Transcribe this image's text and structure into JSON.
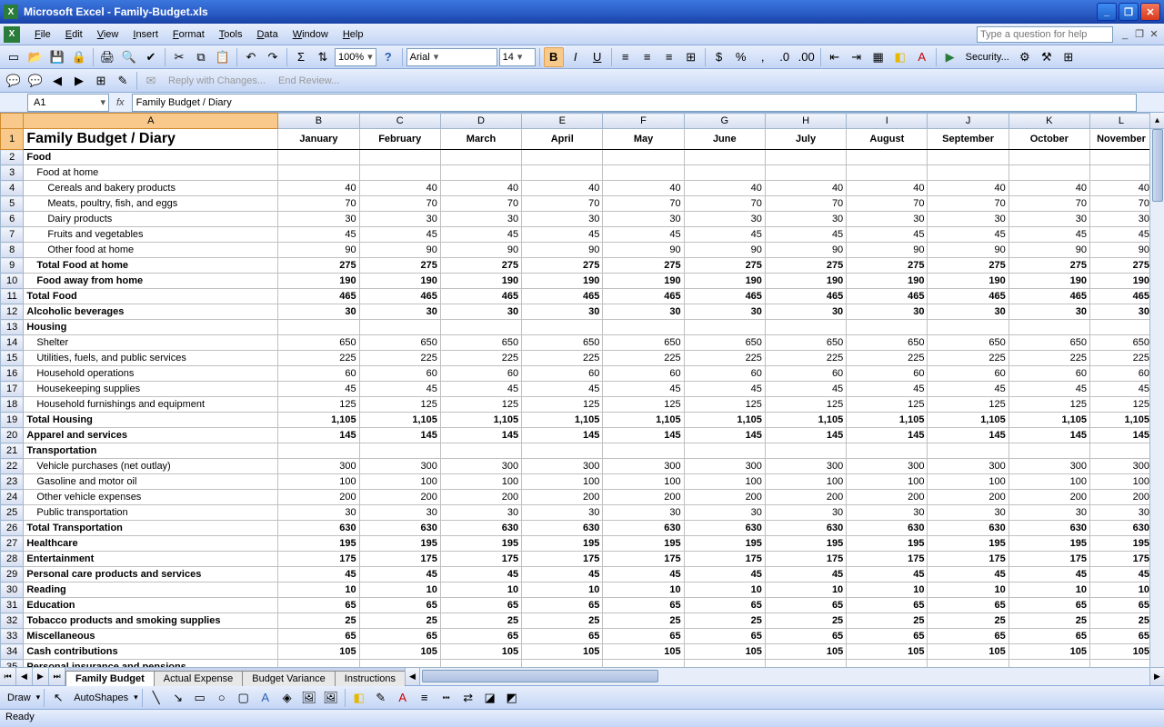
{
  "app": {
    "title": "Microsoft Excel - Family-Budget.xls"
  },
  "menu": [
    "File",
    "Edit",
    "View",
    "Insert",
    "Format",
    "Tools",
    "Data",
    "Window",
    "Help"
  ],
  "help_placeholder": "Type a question for help",
  "toolbar": {
    "zoom": "100%",
    "font": "Arial",
    "size": "14",
    "reply": "Reply with Changes...",
    "endreview": "End Review...",
    "security": "Security..."
  },
  "namebox": "A1",
  "formula": "Family Budget / Diary",
  "columns": [
    "A",
    "B",
    "C",
    "D",
    "E",
    "F",
    "G",
    "H",
    "I",
    "J",
    "K",
    "L"
  ],
  "months": [
    "January",
    "February",
    "March",
    "April",
    "May",
    "June",
    "July",
    "August",
    "September",
    "October",
    "November"
  ],
  "rows": [
    {
      "n": 1,
      "type": "title",
      "a": "Family Budget / Diary",
      "header": true
    },
    {
      "n": 2,
      "type": "section",
      "a": "Food"
    },
    {
      "n": 3,
      "type": "sub1",
      "a": "Food at home"
    },
    {
      "n": 4,
      "type": "sub2",
      "a": "Cereals and bakery products",
      "v": 40
    },
    {
      "n": 5,
      "type": "sub2",
      "a": "Meats, poultry, fish, and eggs",
      "v": 70
    },
    {
      "n": 6,
      "type": "sub2",
      "a": "Dairy products",
      "v": 30
    },
    {
      "n": 7,
      "type": "sub2",
      "a": "Fruits and vegetables",
      "v": 45
    },
    {
      "n": 8,
      "type": "sub2",
      "a": "Other food at home",
      "v": 90
    },
    {
      "n": 9,
      "type": "bold",
      "a": "Total Food at home",
      "v": 275
    },
    {
      "n": 10,
      "type": "bold",
      "a": "Food away from home",
      "v": 190
    },
    {
      "n": 11,
      "type": "section",
      "a": "Total Food",
      "v": 465
    },
    {
      "n": 12,
      "type": "section",
      "a": "Alcoholic beverages",
      "v": 30
    },
    {
      "n": 13,
      "type": "section",
      "a": "Housing"
    },
    {
      "n": 14,
      "type": "sub1",
      "a": "Shelter",
      "v": 650
    },
    {
      "n": 15,
      "type": "sub1",
      "a": "Utilities, fuels, and public services",
      "v": 225
    },
    {
      "n": 16,
      "type": "sub1",
      "a": "Household operations",
      "v": 60
    },
    {
      "n": 17,
      "type": "sub1",
      "a": "Housekeeping supplies",
      "v": 45
    },
    {
      "n": 18,
      "type": "sub1",
      "a": "Household furnishings and equipment",
      "v": 125
    },
    {
      "n": 19,
      "type": "section",
      "a": "Total Housing",
      "v": "1,105"
    },
    {
      "n": 20,
      "type": "section",
      "a": "Apparel and services",
      "v": 145
    },
    {
      "n": 21,
      "type": "section",
      "a": "Transportation"
    },
    {
      "n": 22,
      "type": "sub1",
      "a": "Vehicle purchases (net outlay)",
      "v": 300
    },
    {
      "n": 23,
      "type": "sub1",
      "a": "Gasoline and motor oil",
      "v": 100
    },
    {
      "n": 24,
      "type": "sub1",
      "a": "Other vehicle expenses",
      "v": 200
    },
    {
      "n": 25,
      "type": "sub1",
      "a": "Public transportation",
      "v": 30
    },
    {
      "n": 26,
      "type": "section",
      "a": "Total Transportation",
      "v": 630
    },
    {
      "n": 27,
      "type": "section",
      "a": "Healthcare",
      "v": 195
    },
    {
      "n": 28,
      "type": "section",
      "a": "Entertainment",
      "v": 175
    },
    {
      "n": 29,
      "type": "section",
      "a": "Personal care products and services",
      "v": 45
    },
    {
      "n": 30,
      "type": "section",
      "a": "Reading",
      "v": 10
    },
    {
      "n": 31,
      "type": "section",
      "a": "Education",
      "v": 65
    },
    {
      "n": 32,
      "type": "section",
      "a": "Tobacco products and smoking supplies",
      "v": 25
    },
    {
      "n": 33,
      "type": "section",
      "a": "Miscellaneous",
      "v": 65
    },
    {
      "n": 34,
      "type": "section",
      "a": "Cash contributions",
      "v": 105
    },
    {
      "n": 35,
      "type": "section",
      "a": "Personal insurance and pensions"
    }
  ],
  "sheets": [
    "Family Budget",
    "Actual Expense",
    "Budget Variance",
    "Instructions"
  ],
  "active_sheet": 0,
  "draw_label": "Draw",
  "autoshapes": "AutoShapes",
  "status": "Ready"
}
